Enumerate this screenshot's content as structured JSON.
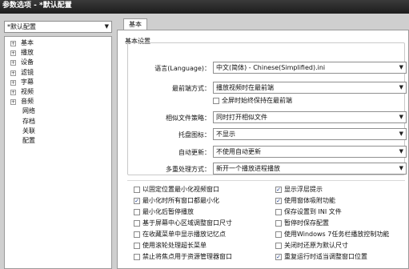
{
  "window": {
    "title": "参数选项 - *默认配置"
  },
  "profile": {
    "selected": "*默认配置"
  },
  "tree": {
    "items": [
      {
        "label": "基本",
        "expandable": true
      },
      {
        "label": "播放",
        "expandable": true
      },
      {
        "label": "设备",
        "expandable": true
      },
      {
        "label": "滤镜",
        "expandable": true
      },
      {
        "label": "字幕",
        "expandable": true
      },
      {
        "label": "视频",
        "expandable": true
      },
      {
        "label": "音频",
        "expandable": true
      },
      {
        "label": "网络",
        "expandable": false
      },
      {
        "label": "存档",
        "expandable": false
      },
      {
        "label": "关联",
        "expandable": false
      },
      {
        "label": "配置",
        "expandable": false
      }
    ]
  },
  "tabs": [
    {
      "label": "基本"
    }
  ],
  "basic": {
    "group_title": "基本设置",
    "language": {
      "label": "语言(Language)：",
      "value": "中文(简体) - Chinese(Simplified).ini"
    },
    "ontop": {
      "label": "最前端方式：",
      "value": "播放视频时在最前端"
    },
    "fullscreen_ontop": {
      "label": "全屏时始终保持在最前端",
      "checked": false
    },
    "similar_files": {
      "label": "相似文件策略：",
      "value": "同时打开相似文件"
    },
    "tray_icon": {
      "label": "托盘图标：",
      "value": "不显示"
    },
    "auto_update": {
      "label": "自动更新：",
      "value": "不使用自动更新"
    },
    "multi_process": {
      "label": "多重处理方式：",
      "value": "新开一个播放进程播放"
    }
  },
  "options_left": [
    {
      "label": "以固定位置最小化视频窗口",
      "checked": false
    },
    {
      "label": "最小化时所有窗口都最小化",
      "checked": true
    },
    {
      "label": "最小化后暂停播放",
      "checked": false
    },
    {
      "label": "基于屏幕中心区域调整窗口尺寸",
      "checked": false
    },
    {
      "label": "在收藏菜单中显示播放记忆点",
      "checked": false
    },
    {
      "label": "使用滚轮处理超长菜单",
      "checked": false
    },
    {
      "label": "禁止将焦点用于资源管理器窗口",
      "checked": false
    }
  ],
  "options_right": [
    {
      "label": "显示浮层提示",
      "checked": true
    },
    {
      "label": "使用窗体吸附功能",
      "checked": true
    },
    {
      "label": "保存设置到 INI 文件",
      "checked": false
    },
    {
      "label": "暂停时保存配置",
      "checked": false
    },
    {
      "label": "使用Windows 7任务栏播放控制功能",
      "checked": false
    },
    {
      "label": "关闭时还原为默认尺寸",
      "checked": false
    },
    {
      "label": "重复运行时适当调整窗口位置",
      "checked": true
    }
  ],
  "icons": {
    "dropdown": "chevron-down-icon",
    "checkmark": "checkmark-icon",
    "expand": "plus-icon"
  }
}
